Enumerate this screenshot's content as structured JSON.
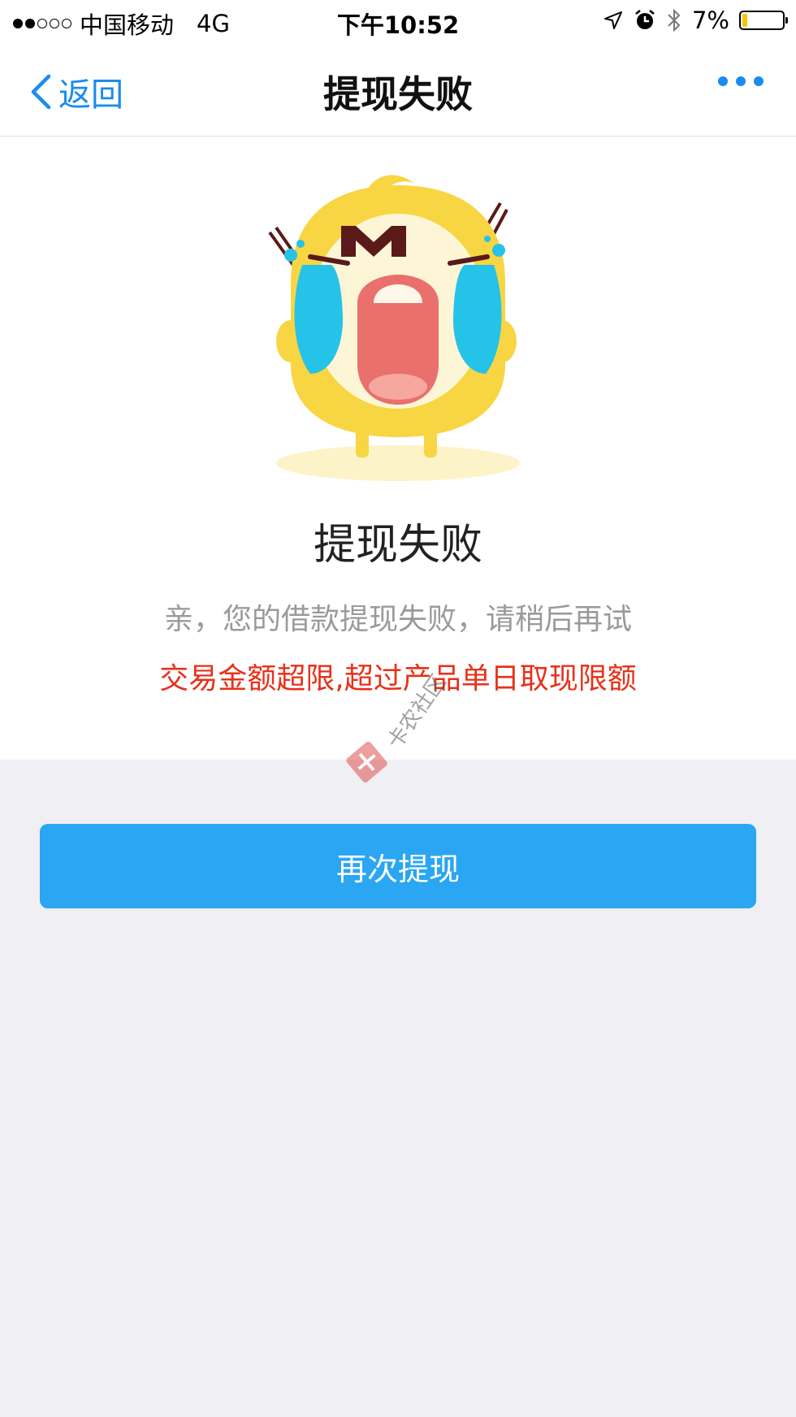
{
  "status_bar": {
    "carrier": "中国移动",
    "network": "4G",
    "time": "下午10:52",
    "battery_percent": "7%",
    "battery_level": 0.07,
    "signal_bars_filled": 2,
    "signal_bars_total": 5,
    "icons": [
      "location-icon",
      "alarm-icon",
      "bluetooth-icon",
      "battery-icon"
    ]
  },
  "nav": {
    "back_label": "返回",
    "title": "提现失败",
    "more_icon": "more-dots-icon",
    "accent_color": "#1a8cf0"
  },
  "result": {
    "mascot": "crying-mascot-illustration",
    "title": "提现失败",
    "subtitle": "亲，您的借款提现失败，请稍后再试",
    "error_reason": "交易金额超限,超过产品单日取现限额",
    "error_color": "#e8311a"
  },
  "watermark": {
    "text": "卡农社区"
  },
  "actions": {
    "retry_label": "再次提现",
    "retry_color": "#2aa6f2"
  }
}
